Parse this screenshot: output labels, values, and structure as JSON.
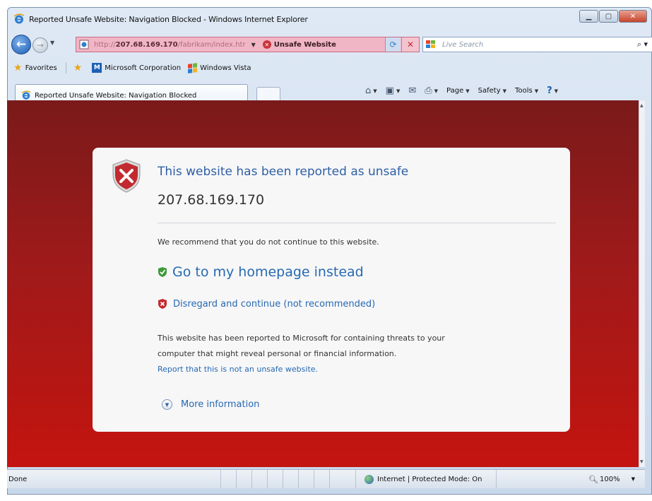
{
  "window": {
    "title": "Reported Unsafe Website: Navigation Blocked - Windows Internet Explorer"
  },
  "toolbar": {
    "address_url_prefix": "http://",
    "address_url_host": "207.68.169.170",
    "address_url_path": "/fabrikam/index.htr",
    "address_status": "Unsafe Website",
    "search_placeholder": "Live Search"
  },
  "favorites": {
    "items": [
      {
        "label": "Favorites",
        "icon": "star-icon"
      },
      {
        "label": "Microsoft Corporation",
        "icon": "microsoft-icon"
      },
      {
        "label": "Windows Vista",
        "icon": "windows-flag-icon"
      }
    ]
  },
  "tabs": {
    "active_label": "Reported Unsafe Website: Navigation Blocked"
  },
  "commandbar": {
    "items": [
      "Page",
      "Safety",
      "Tools"
    ]
  },
  "warning": {
    "title": "This website has been reported as unsafe",
    "host": "207.68.169.170",
    "recommend": "We recommend that you do not continue to this website.",
    "home_link": "Go to my homepage instead",
    "continue_link": "Disregard and continue (not recommended)",
    "explain_line1": "This website has been reported to Microsoft for containing threats to your",
    "explain_line2": "computer that might reveal personal or financial information.",
    "report_link": "Report that this is not an unsafe website.",
    "more_info": "More information"
  },
  "status": {
    "left": "Done",
    "zone": "Internet | Protected Mode: On",
    "zoom": "100%"
  },
  "colors": {
    "danger_top": "#7a1a1a",
    "danger_bottom": "#c4140f",
    "link": "#2769b1",
    "address_unsafe": "#f0b6c6"
  }
}
